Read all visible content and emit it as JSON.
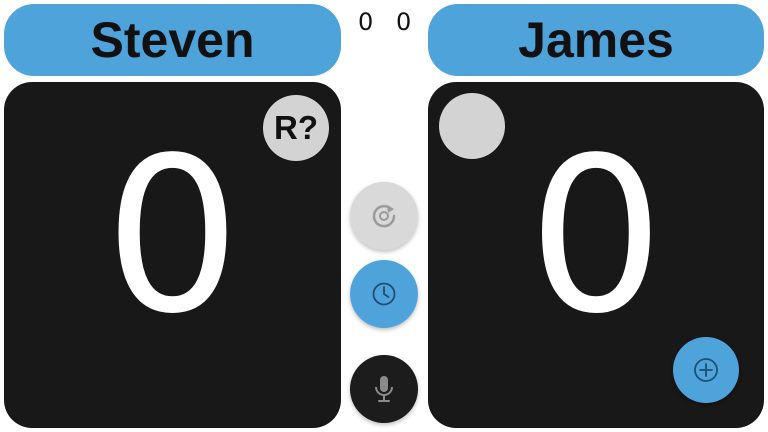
{
  "colors": {
    "pill_bg": "#4fa3db",
    "panel_bg": "#181818",
    "accent": "#4fa3db",
    "indicator_grey": "#d3d3d3"
  },
  "players": [
    {
      "name": "Steven",
      "sets": "0",
      "score": "0",
      "serve_indicator": "R?"
    },
    {
      "name": "James",
      "sets": "0",
      "score": "0",
      "serve_indicator": ""
    }
  ],
  "controls": {
    "swap_icon": "rotate-icon",
    "timer_icon": "clock-icon",
    "mic_icon": "microphone-icon",
    "add_icon": "plus-circle-icon"
  }
}
